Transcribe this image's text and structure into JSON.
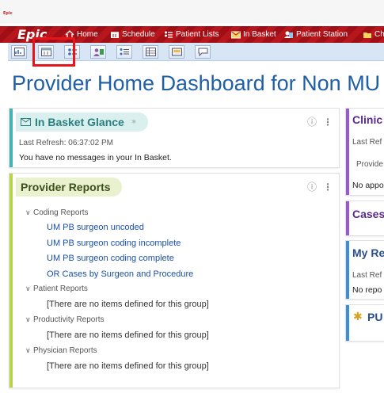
{
  "app": {
    "small_logo": "Epic",
    "brand_logo": "Epic"
  },
  "activity_bar": {
    "items": [
      {
        "label": "Home",
        "icon": "home-icon"
      },
      {
        "label": "Schedule",
        "icon": "calendar-icon"
      },
      {
        "label": "Patient Lists",
        "icon": "patient-list-icon"
      },
      {
        "label": "In Basket",
        "icon": "envelope-icon"
      },
      {
        "label": "Patient Station",
        "icon": "patient-station-icon"
      },
      {
        "label": "Ch",
        "icon": "chart-icon"
      }
    ]
  },
  "toolbar": {
    "buttons": [
      {
        "icon": "dashboard-icon"
      },
      {
        "icon": "calendar-icon"
      },
      {
        "icon": "patient-list-icon"
      },
      {
        "icon": "patients-icon"
      },
      {
        "icon": "list-icon"
      },
      {
        "icon": "grid-icon"
      },
      {
        "icon": "inbox-icon"
      },
      {
        "icon": "chat-icon"
      }
    ],
    "highlight_color": "#e8141c"
  },
  "page": {
    "title": "Provider Home Dashboard for Non MU P"
  },
  "in_basket_panel": {
    "title": "In Basket Glance",
    "last_refresh": "Last Refresh: 06:37:02 PM",
    "message": "You have no messages in your In Basket.",
    "accent_color": "#44b3b3"
  },
  "provider_reports_panel": {
    "title": "Provider Reports",
    "accent_color": "#b9d547",
    "groups": [
      {
        "label": "Coding Reports",
        "items": [
          "UM PB surgeon uncoded",
          "UM PB surgeon coding incomplete",
          "UM PB surgeon coding complete",
          "OR Cases by Surgeon and Procedure"
        ]
      },
      {
        "label": "Patient Reports",
        "empty": "[There are no items defined for this group]"
      },
      {
        "label": "Productivity Reports",
        "empty": "[There are no items defined for this group]"
      },
      {
        "label": "Physician Reports",
        "empty": "[There are no items defined for this group]"
      }
    ]
  },
  "right_column": {
    "clinic": {
      "title": "Clinic",
      "last_refresh": "Last Ref",
      "provider": "Provide",
      "no_appointments": "No appo",
      "accent_color": "#9b59d0"
    },
    "cases": {
      "title": "Cases",
      "accent_color": "#9b59d0"
    },
    "my_reports": {
      "title": "My Re",
      "last_refresh": "Last Ref",
      "no_reports": "No repo",
      "accent_color": "#3a8fd8"
    },
    "pub": {
      "title": "PU",
      "accent_color": "#3a8fd8"
    }
  }
}
